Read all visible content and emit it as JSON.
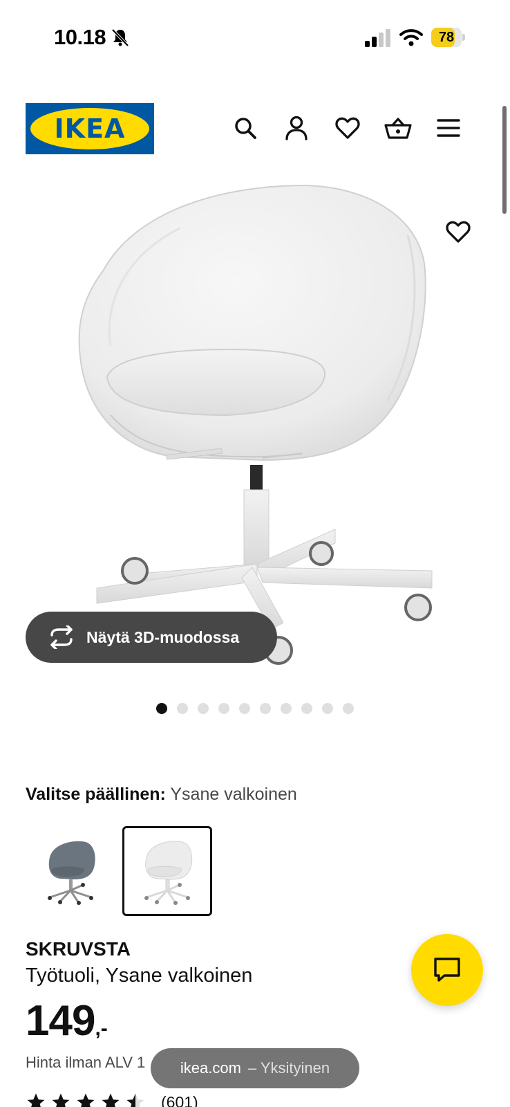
{
  "status_bar": {
    "time": "10.18",
    "battery": "78",
    "battery_fraction": 0.78
  },
  "header": {
    "logo_text": "IKEA",
    "icons": [
      "search-icon",
      "profile-icon",
      "heart-icon",
      "basket-icon",
      "menu-icon"
    ]
  },
  "gallery": {
    "view_3d_label": "Näytä 3D-muodossa",
    "image_count": 10,
    "active_index": 0
  },
  "cover": {
    "label": "Valitse päällinen:",
    "value": "Ysane valkoinen",
    "options": [
      {
        "color": "gray-blue",
        "selected": false
      },
      {
        "color": "white",
        "selected": true
      }
    ]
  },
  "product": {
    "name": "SKRUVSTA",
    "description": "Työtuoli, Ysane valkoinen",
    "price": "149",
    "price_suffix": ",-",
    "vat_text": "Hinta ilman ALV 1",
    "rating": 4.5,
    "review_count": "(601)"
  },
  "browser": {
    "domain": "ikea.com",
    "mode": "– Yksityinen"
  },
  "colors": {
    "ikea_blue": "#0058a3",
    "ikea_yellow": "#ffdb00",
    "dark_pill": "#474747"
  }
}
